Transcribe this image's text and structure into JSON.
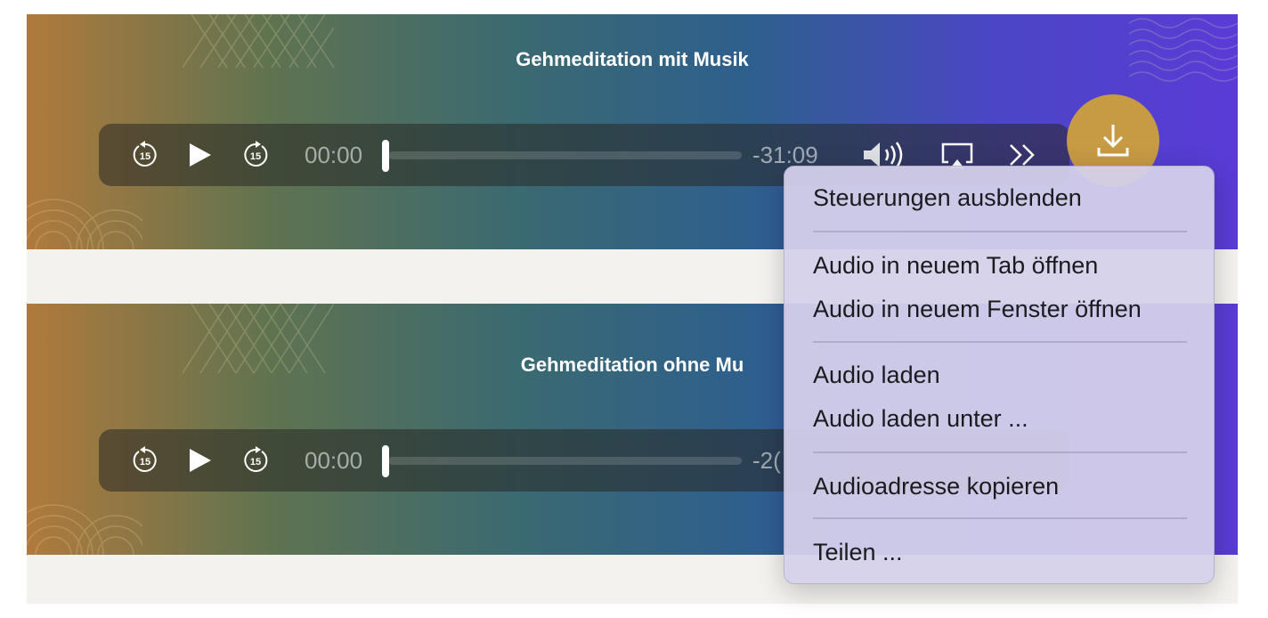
{
  "cards": [
    {
      "title": "Gehmeditation mit Musik",
      "player": {
        "current_time": "00:00",
        "remaining_time": "-31:09",
        "progress": 0
      }
    },
    {
      "title": "Gehmeditation ohne Mu",
      "player": {
        "current_time": "00:00",
        "remaining_time": "-2(",
        "progress": 0
      }
    }
  ],
  "icons": {
    "skip_back": "skip-back-15-icon",
    "play": "play-icon",
    "skip_forward": "skip-forward-15-icon",
    "volume": "speaker-icon",
    "airplay": "airplay-icon",
    "overflow": "chevron-double-right-icon",
    "download": "download-icon"
  },
  "skip_label": "15",
  "context_menu": {
    "groups": [
      [
        "Steuerungen ausblenden"
      ],
      [
        "Audio in neuem Tab öffnen",
        "Audio in neuem Fenster öffnen"
      ],
      [
        "Audio laden",
        "Audio laden unter ..."
      ],
      [
        "Audioadresse kopieren"
      ],
      [
        "Teilen ..."
      ]
    ]
  },
  "colors": {
    "gradient_start": "#b07a3c",
    "gradient_end": "#5a3bd6",
    "download_button": "#c79a44",
    "page_background": "#f3f2ef"
  }
}
